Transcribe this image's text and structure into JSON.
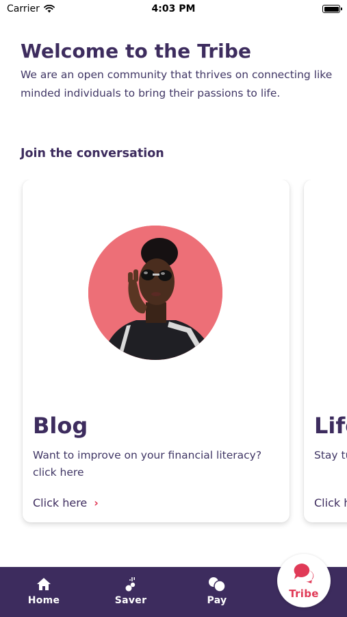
{
  "status_bar": {
    "carrier": "Carrier",
    "time": "4:03 PM",
    "battery_level": 1.0
  },
  "header": {
    "title": "Welcome to the Tribe",
    "intro": "We are an open community that thrives on connecting like minded individuals to bring their passions to life."
  },
  "section": {
    "heading": "Join the conversation"
  },
  "cards": [
    {
      "title": "Blog",
      "description": "Want to improve on your financial literacy? click here",
      "link": "Click here"
    },
    {
      "title": "Life",
      "description": "Stay tu",
      "link": "Click h"
    }
  ],
  "tabs": [
    {
      "label": "Home",
      "icon": "home-icon"
    },
    {
      "label": "Saver",
      "icon": "saver-icon"
    },
    {
      "label": "Pay",
      "icon": "pay-icon"
    },
    {
      "label": "Tribe",
      "icon": "chat-bubbles-icon",
      "active": true
    }
  ],
  "colors": {
    "primary": "#3d2c5e",
    "accent": "#e03a57",
    "tab_bar": "#3d2c5e",
    "photo_bg": "#ec6a72"
  }
}
